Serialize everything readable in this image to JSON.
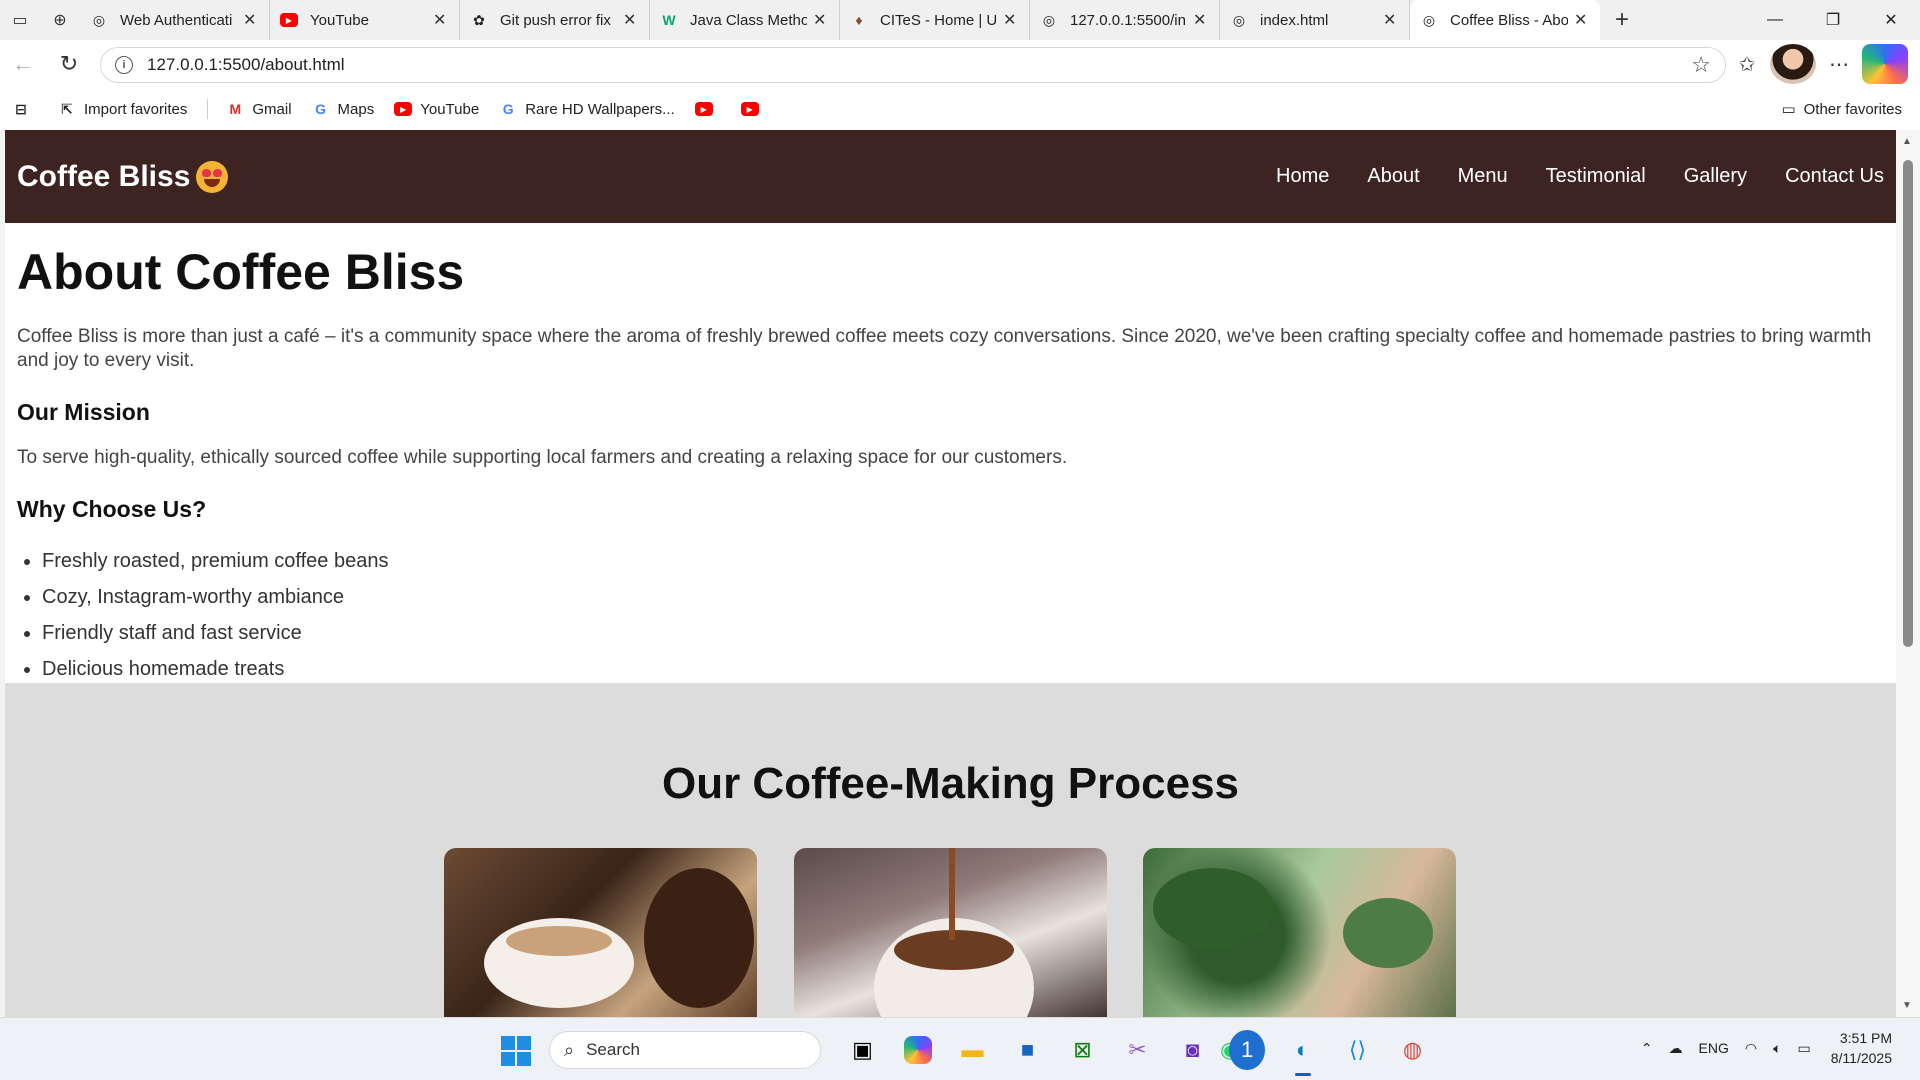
{
  "browser": {
    "tabs": [
      {
        "title": "Web Authenticati",
        "icon": "globe-icon"
      },
      {
        "title": "YouTube",
        "icon": "youtube-icon"
      },
      {
        "title": "Git push error fix",
        "icon": "chatgpt-icon"
      },
      {
        "title": "Java Class Metho",
        "icon": "w3schools-icon"
      },
      {
        "title": "CITeS - Home | U",
        "icon": "cites-icon"
      },
      {
        "title": "127.0.0.1:5500/in",
        "icon": "globe-icon"
      },
      {
        "title": "index.html",
        "icon": "globe-icon"
      },
      {
        "title": "Coffee Bliss - Abo",
        "icon": "globe-icon",
        "active": true
      }
    ],
    "url": "127.0.0.1:5500/about.html",
    "favorites": [
      {
        "label": "Import favorites",
        "icon": "import-icon"
      },
      {
        "label": "Gmail",
        "icon": "gmail-icon"
      },
      {
        "label": "Maps",
        "icon": "google-icon"
      },
      {
        "label": "YouTube",
        "icon": "youtube-icon"
      },
      {
        "label": "Rare HD Wallpapers...",
        "icon": "google-icon"
      }
    ],
    "other_favorites": "Other favorites"
  },
  "site": {
    "brand": "Coffee Bliss",
    "nav": [
      "Home",
      "About",
      "Menu",
      "Testimonial",
      "Gallery",
      "Contact Us"
    ],
    "about": {
      "title": "About Coffee Bliss",
      "intro": "Coffee Bliss is more than just a café – it's a community space where the aroma of freshly brewed coffee meets cozy conversations. Since 2020, we've been crafting specialty coffee and homemade pastries to bring warmth and joy to every visit.",
      "mission_heading": "Our Mission",
      "mission_text": "To serve high-quality, ethically sourced coffee while supporting local farmers and creating a relaxing space for our customers.",
      "why_heading": "Why Choose Us?",
      "reasons": [
        "Freshly roasted, premium coffee beans",
        "Cozy, Instagram-worthy ambiance",
        "Friendly staff and fast service",
        "Delicious homemade treats"
      ]
    },
    "process": {
      "title": "Our Coffee-Making Process"
    }
  },
  "taskbar": {
    "search_placeholder": "Search",
    "whatsapp_badge": "1",
    "language": "ENG",
    "time": "3:51 PM",
    "date": "8/11/2025"
  }
}
